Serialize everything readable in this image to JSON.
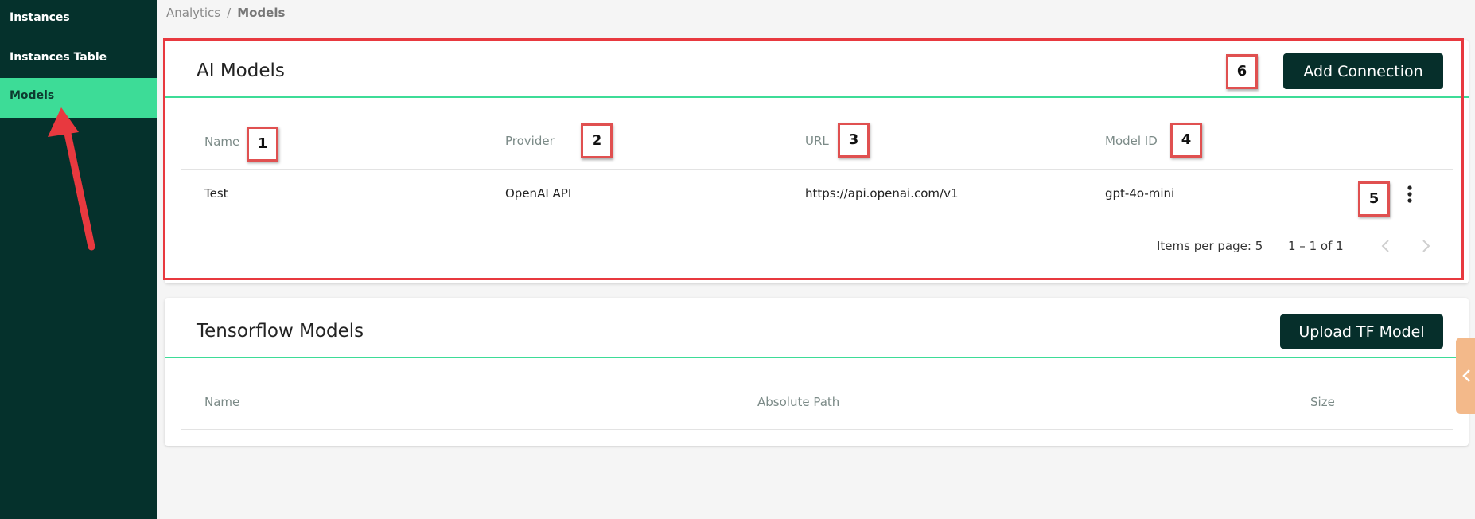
{
  "sidebar": {
    "items": [
      {
        "label": "Instances"
      },
      {
        "label": "Instances Table"
      },
      {
        "label": "Models"
      }
    ]
  },
  "breadcrumb": {
    "parent": "Analytics",
    "separator": "/",
    "current": "Models"
  },
  "ai_models": {
    "title": "AI Models",
    "add_button": "Add Connection",
    "columns": [
      "Name",
      "Provider",
      "URL",
      "Model ID"
    ],
    "rows": [
      {
        "name": "Test",
        "provider": "OpenAI API",
        "url": "https://api.openai.com/v1",
        "model_id": "gpt-4o-mini"
      }
    ],
    "pagination": {
      "items_per_page_label": "Items per page:",
      "items_per_page": "5",
      "range": "1 – 1 of 1"
    }
  },
  "tensorflow_models": {
    "title": "Tensorflow Models",
    "upload_button": "Upload TF Model",
    "columns": [
      "Name",
      "Absolute Path",
      "Size"
    ]
  },
  "annotations": {
    "n1": "1",
    "n2": "2",
    "n3": "3",
    "n4": "4",
    "n5": "5",
    "n6": "6"
  },
  "colors": {
    "sidebar": "#05312c",
    "accent": "#3ddc97",
    "button": "#062f2b",
    "annotation": "#e8393f"
  },
  "icons": {
    "row_menu": "more-vertical-icon",
    "prev": "chevron-left-icon",
    "next": "chevron-right-icon",
    "side_tab": "chevron-left-icon"
  }
}
